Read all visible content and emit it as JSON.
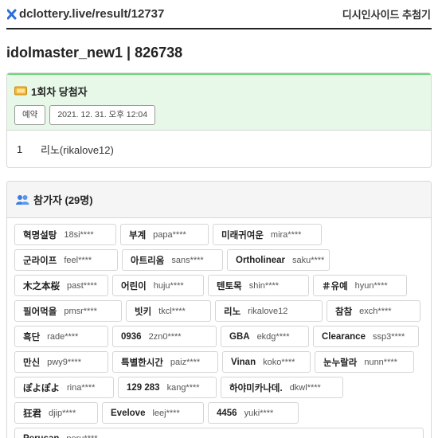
{
  "header": {
    "url": "dclottery.live/result/12737",
    "site_name": "디시인사이드 추첨기"
  },
  "page_title": "idolmaster_new1 | 826738",
  "winner_section": {
    "title": "1회차 당첨자",
    "tags": [
      "예약",
      "2021. 12. 31. 오후 12:04"
    ],
    "winners": [
      {
        "rank": "1",
        "name": "리노(rikalove12)"
      }
    ]
  },
  "participants_section": {
    "title": "참가자 (29명)",
    "participants": [
      {
        "name": "혁명설탕",
        "id": "18si****"
      },
      {
        "name": "부계",
        "id": "papa****"
      },
      {
        "name": "미래귀여운",
        "id": "mira****"
      },
      {
        "name": "군라이프",
        "id": "feel****"
      },
      {
        "name": "아트리옴",
        "id": "sans****"
      },
      {
        "name": "Ortholinear",
        "id": "saku****"
      },
      {
        "name": "木之本桜",
        "id": "past****"
      },
      {
        "name": "어린이",
        "id": "huju****"
      },
      {
        "name": "텐토목",
        "id": "shin****"
      },
      {
        "name": "＃유예",
        "id": "hyun****"
      },
      {
        "name": "필어먹을",
        "id": "pmsr****"
      },
      {
        "name": "빗키",
        "id": "tkcl****"
      },
      {
        "name": "리노",
        "id": "rikalove12"
      },
      {
        "name": "참참",
        "id": "exch****"
      },
      {
        "name": "흑단",
        "id": "rade****"
      },
      {
        "name": "0936",
        "id": "2zn0****"
      },
      {
        "name": "GBA",
        "id": "ekdg****"
      },
      {
        "name": "Clearance",
        "id": "ssp3****"
      },
      {
        "name": "만신",
        "id": "pwy9****"
      },
      {
        "name": "특별한시간",
        "id": "paiz****"
      },
      {
        "name": "Vinan",
        "id": "koko****"
      },
      {
        "name": "눈누랄라",
        "id": "nunn****"
      },
      {
        "name": "ぽよぽよ",
        "id": "rina****"
      },
      {
        "name": "129 283",
        "id": "kang****"
      },
      {
        "name": "하야미카나데.",
        "id": "dkwl****"
      },
      {
        "name": "狂君",
        "id": "djip****"
      },
      {
        "name": "Evelove",
        "id": "leej****"
      },
      {
        "name": "4456",
        "id": "yuki****"
      },
      {
        "name": "Perusan",
        "id": "peru****"
      }
    ]
  }
}
